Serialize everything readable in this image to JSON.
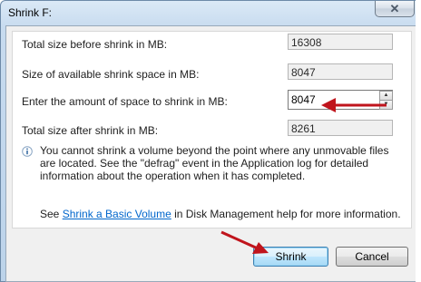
{
  "window": {
    "title": "Shrink F:",
    "close_glyph": "✕"
  },
  "fields": {
    "total_before_label": "Total size before shrink in MB:",
    "total_before_value": "16308",
    "available_label": "Size of available shrink space in MB:",
    "available_value": "8047",
    "amount_label": "Enter the amount of space to shrink in MB:",
    "amount_value": "8047",
    "total_after_label": "Total size after shrink in MB:",
    "total_after_value": "8261"
  },
  "info": {
    "icon": "info-icon",
    "text": "You cannot shrink a volume beyond the point where any unmovable files are located. See the \"defrag\" event in the Application log for detailed information about the operation when it has completed."
  },
  "help": {
    "prefix": "See ",
    "link_text": "Shrink a Basic Volume",
    "suffix": " in Disk Management help for more information."
  },
  "buttons": {
    "shrink": "Shrink",
    "cancel": "Cancel"
  },
  "colors": {
    "annotation_arrow": "#c0141c",
    "link": "#0066cc"
  }
}
